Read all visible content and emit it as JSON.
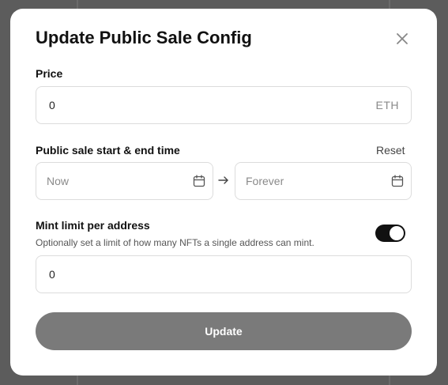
{
  "modal": {
    "title": "Update Public Sale Config"
  },
  "price": {
    "label": "Price",
    "value": "0",
    "currency": "ETH"
  },
  "sale_time": {
    "label": "Public sale start & end time",
    "reset_label": "Reset",
    "start_placeholder": "Now",
    "end_placeholder": "Forever"
  },
  "mint_limit": {
    "label": "Mint limit per address",
    "helper": "Optionally set a limit of how many NFTs a single address can mint.",
    "enabled": true,
    "value": "0"
  },
  "actions": {
    "update_label": "Update"
  },
  "icons": {
    "close": "close-icon",
    "calendar": "calendar-icon",
    "arrow": "arrow-right-icon"
  },
  "colors": {
    "toggle_on": "#111111",
    "button_disabled": "#7a7a7a"
  }
}
